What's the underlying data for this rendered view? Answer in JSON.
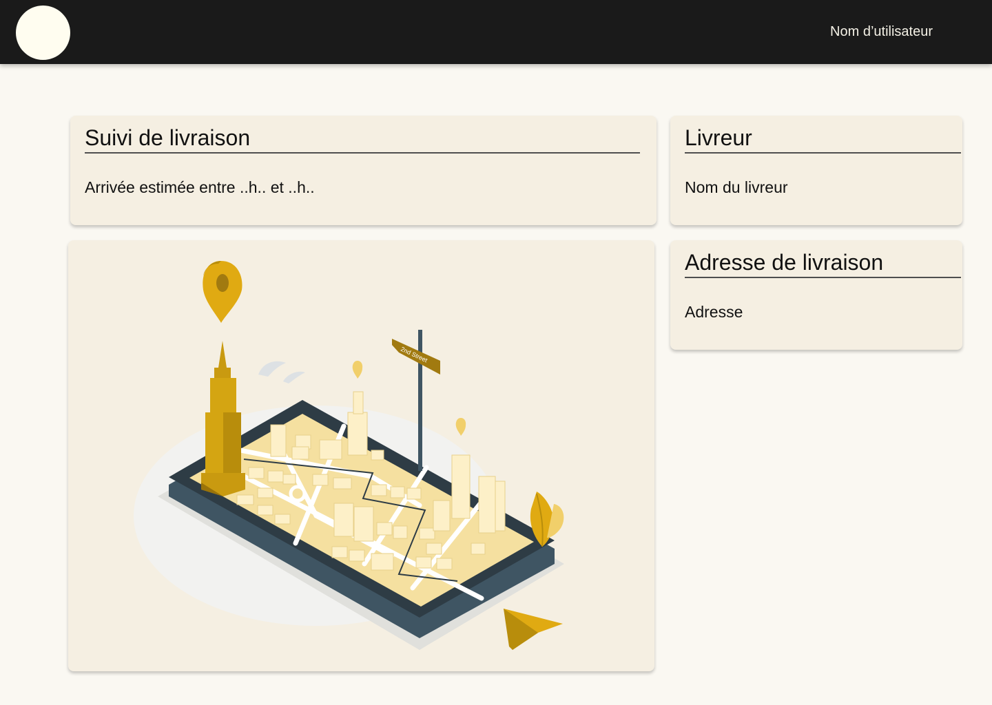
{
  "header": {
    "username": "Nom d’utilisateur"
  },
  "tracking": {
    "title": "Suivi de livraison",
    "eta": "Arrivée estimée entre ..h.. et ..h.."
  },
  "courier": {
    "title": "Livreur",
    "name": "Nom du livreur"
  },
  "address": {
    "title": "Adresse de livraison",
    "value": "Adresse"
  },
  "map": {
    "street_sign": "2nd Street"
  },
  "colors": {
    "topbar": "#1a1a1a",
    "background": "#faf8f2",
    "card": "#f5efe2",
    "accent": "#e0aa12"
  }
}
